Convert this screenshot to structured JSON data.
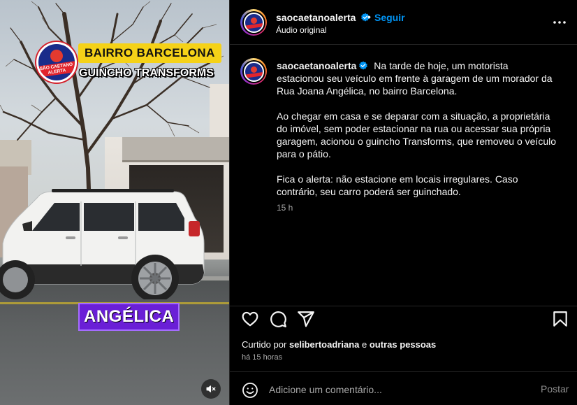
{
  "media": {
    "logo_text": "SÃO CAETANO ALERTA",
    "tag_neighborhood": "BAIRRO BARCELONA",
    "tag_company": "GUINCHO TRANSFORMS",
    "tag_street": "ANGÉLICA"
  },
  "header": {
    "username": "saocaetanoalerta",
    "separator": "•",
    "follow_label": "Seguir",
    "audio_label": "Áudio original"
  },
  "caption": {
    "username": "saocaetanoalerta",
    "paragraphs": [
      "Na tarde de hoje, um motorista estacionou seu veículo em frente à garagem de um morador da Rua Joana Angélica, no bairro Barcelona.",
      "Ao chegar em casa e se deparar com a situação, a proprietária do imóvel, sem poder estacionar na rua ou acessar sua própria garagem, acionou o guincho Transforms, que removeu o veículo para o pátio.",
      "Fica o alerta: não estacione em locais irregulares. Caso contrário, seu carro poderá ser guinchado."
    ],
    "timestamp": "15 h"
  },
  "likes": {
    "prefix": "Curtido por",
    "user": "selibertoadriana",
    "connector": "e",
    "others": "outras pessoas"
  },
  "posted_ago": "há 15 horas",
  "comment": {
    "placeholder": "Adicione um comentário...",
    "post_label": "Postar"
  },
  "colors": {
    "accent": "#0095f6",
    "verified": "#0095f6",
    "tag_yellow": "#f5d218",
    "tag_purple": "#6a1fd6"
  },
  "icons": [
    "heart-icon",
    "comment-icon",
    "share-icon",
    "bookmark-icon",
    "more-icon",
    "emoji-icon",
    "mute-icon",
    "verified-icon"
  ]
}
